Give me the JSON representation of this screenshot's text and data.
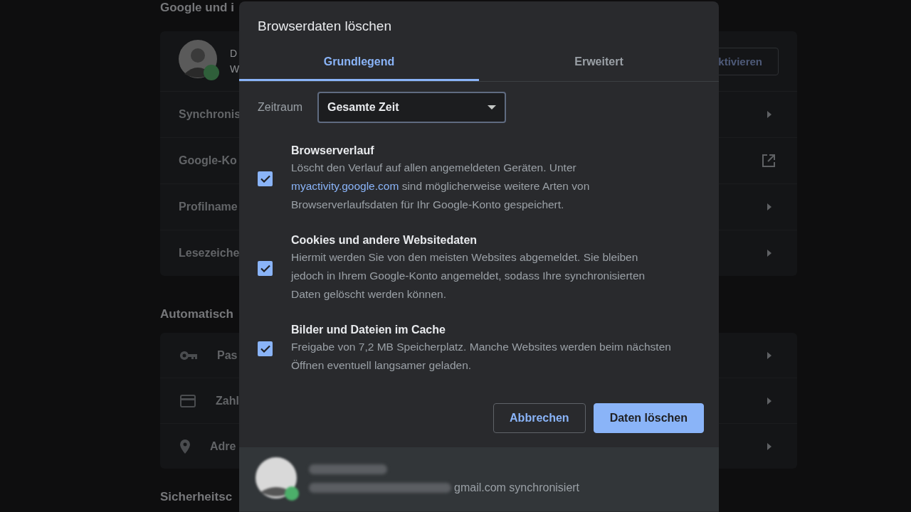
{
  "background": {
    "section_1": {
      "heading": "Google und i",
      "profile": {
        "name": "D",
        "subtitle": "W",
        "button": "ktivieren"
      },
      "rows": [
        {
          "label": "Synchronis",
          "kind": "arrow"
        },
        {
          "label": "Google-Ko",
          "kind": "external"
        },
        {
          "label": "Profilname",
          "kind": "arrow"
        },
        {
          "label": "Lesezeiche",
          "kind": "arrow"
        }
      ]
    },
    "section_2": {
      "heading": "Automatisch",
      "rows": [
        {
          "label": "Pas",
          "kind": "key"
        },
        {
          "label": "Zahl",
          "kind": "card"
        },
        {
          "label": "Adre",
          "kind": "pin"
        }
      ]
    },
    "section_3": {
      "heading": "Sicherheitsc"
    }
  },
  "dialog": {
    "title": "Browserdaten löschen",
    "tabs": [
      {
        "label": "Grundlegend",
        "selected": true
      },
      {
        "label": "Erweitert",
        "selected": false
      }
    ],
    "time_range": {
      "label": "Zeitraum",
      "value": "Gesamte Zeit"
    },
    "items": [
      {
        "title": "Browserverlauf",
        "checked": true,
        "description": [
          {
            "kind": "text",
            "text": "Löscht den Verlauf auf allen angemeldeten Geräten. Unter "
          },
          {
            "kind": "link",
            "text": "myactivity.google.com"
          },
          {
            "kind": "text",
            "text": " sind möglicherweise weitere Arten von Browserverlaufsdaten für Ihr Google-Konto gespeichert."
          }
        ]
      },
      {
        "title": "Cookies und andere Websitedaten",
        "checked": true,
        "description": [
          {
            "kind": "text",
            "text": "Hiermit werden Sie von den meisten Websites abgemeldet. Sie bleiben jedoch in Ihrem Google-Konto angemeldet, sodass Ihre synchronisierten Daten gelöscht werden können."
          }
        ]
      },
      {
        "title": "Bilder und Dateien im Cache",
        "checked": true,
        "description": [
          {
            "kind": "text",
            "text": "Freigabe von 7,2 MB Speicherplatz. Manche Websites werden beim nächsten Öffnen eventuell langsamer geladen."
          }
        ]
      }
    ],
    "buttons": [
      {
        "label": "Abbrechen",
        "kind": "secondary"
      },
      {
        "label": "Daten löschen",
        "kind": "primary"
      }
    ],
    "footer": {
      "sync_text": "gmail.com synchronisiert"
    }
  }
}
